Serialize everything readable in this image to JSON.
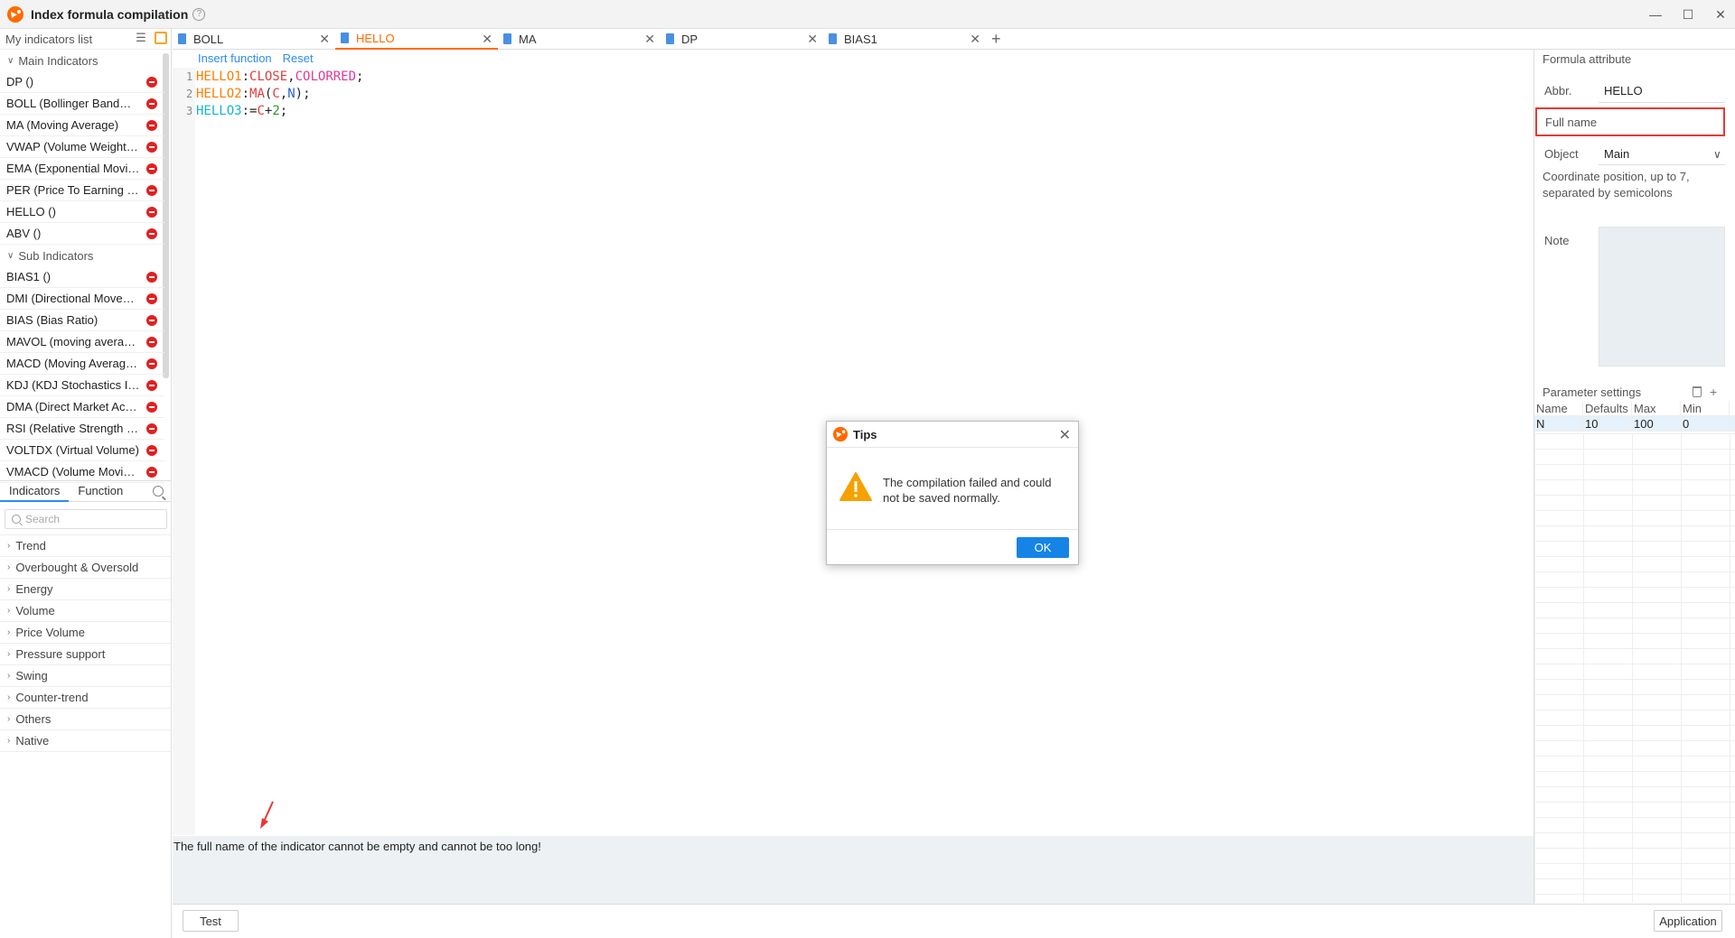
{
  "window": {
    "title": "Index formula compilation",
    "help_glyph": "?",
    "controls": {
      "minimize": "—",
      "maximize": "☐",
      "close": "✕"
    }
  },
  "sidebar": {
    "header": "My indicators list",
    "groups": [
      {
        "label": "Main Indicators",
        "items": [
          "DP ()",
          "BOLL (Bollinger BandWidth)",
          "MA (Moving Average)",
          "VWAP (Volume Weighted Average Price)",
          "EMA (Exponential Moving Average)",
          "PER (Price To Earning Ratio)",
          "HELLO ()",
          "ABV ()"
        ]
      },
      {
        "label": "Sub Indicators",
        "items": [
          "BIAS1 ()",
          "DMI (Directional Movement Index)",
          "BIAS (Bias Ratio)",
          "MAVOL (moving average volume)",
          "MACD (Moving Average Convergence Divergence)",
          "KDJ (KDJ Stochastics Indicator)",
          "DMA (Direct Market Access)",
          "RSI (Relative Strength Index)",
          "VOLTDX (Virtual Volume)",
          "VMACD (Volume Moving Average)"
        ]
      }
    ],
    "tabs": [
      "Indicators",
      "Function"
    ],
    "search_placeholder": "Search",
    "categories": [
      "Trend",
      "Overbought & Oversold",
      "Energy",
      "Volume",
      "Price Volume",
      "Pressure support",
      "Swing",
      "Counter-trend",
      "Others",
      "Native"
    ]
  },
  "tabs": [
    {
      "label": "BOLL",
      "active": false
    },
    {
      "label": "HELLO",
      "active": true
    },
    {
      "label": "MA",
      "active": false
    },
    {
      "label": "DP",
      "active": false
    },
    {
      "label": "BIAS1",
      "active": false
    }
  ],
  "editor": {
    "insert_function": "Insert function",
    "reset": "Reset",
    "lines": [
      {
        "n": "1",
        "name": "HELLO1",
        "op": ":",
        "a": "CLOSE",
        "comma": ",",
        "b": "COLORRED",
        "end": ";"
      },
      {
        "n": "2",
        "name": "HELLO2",
        "op": ":",
        "a": "MA",
        "paren_open": "(",
        "arg1": "C",
        "comma": ",",
        "arg2": "N",
        "paren_close": ")",
        "end": ";"
      },
      {
        "n": "3",
        "name": "HELLO3",
        "op": ":=",
        "a": "C",
        "plus": "+",
        "num": "2",
        "end": ";"
      }
    ],
    "message": "The full name of the indicator cannot be empty and cannot be too long!"
  },
  "buttons": {
    "test": "Test",
    "application": "Application"
  },
  "formula_attribute": {
    "title": "Formula attribute",
    "abbr_label": "Abbr.",
    "abbr_value": "HELLO",
    "full_name_label": "Full name",
    "object_label": "Object",
    "object_value": "Main",
    "coord_text": "Coordinate position, up to 7, separated by semicolons",
    "note_label": "Note",
    "param_title": "Parameter settings",
    "param_headers": [
      "Name",
      "Defaults",
      "Max",
      "Min"
    ],
    "params": [
      [
        "N",
        "10",
        "100",
        "0"
      ]
    ]
  },
  "dialog": {
    "title": "Tips",
    "message": "The compilation failed and could not be saved normally.",
    "ok": "OK"
  },
  "colors": {
    "accent_orange": "#ff6a00",
    "accent_blue": "#1584e6",
    "error_red": "#e53935"
  }
}
